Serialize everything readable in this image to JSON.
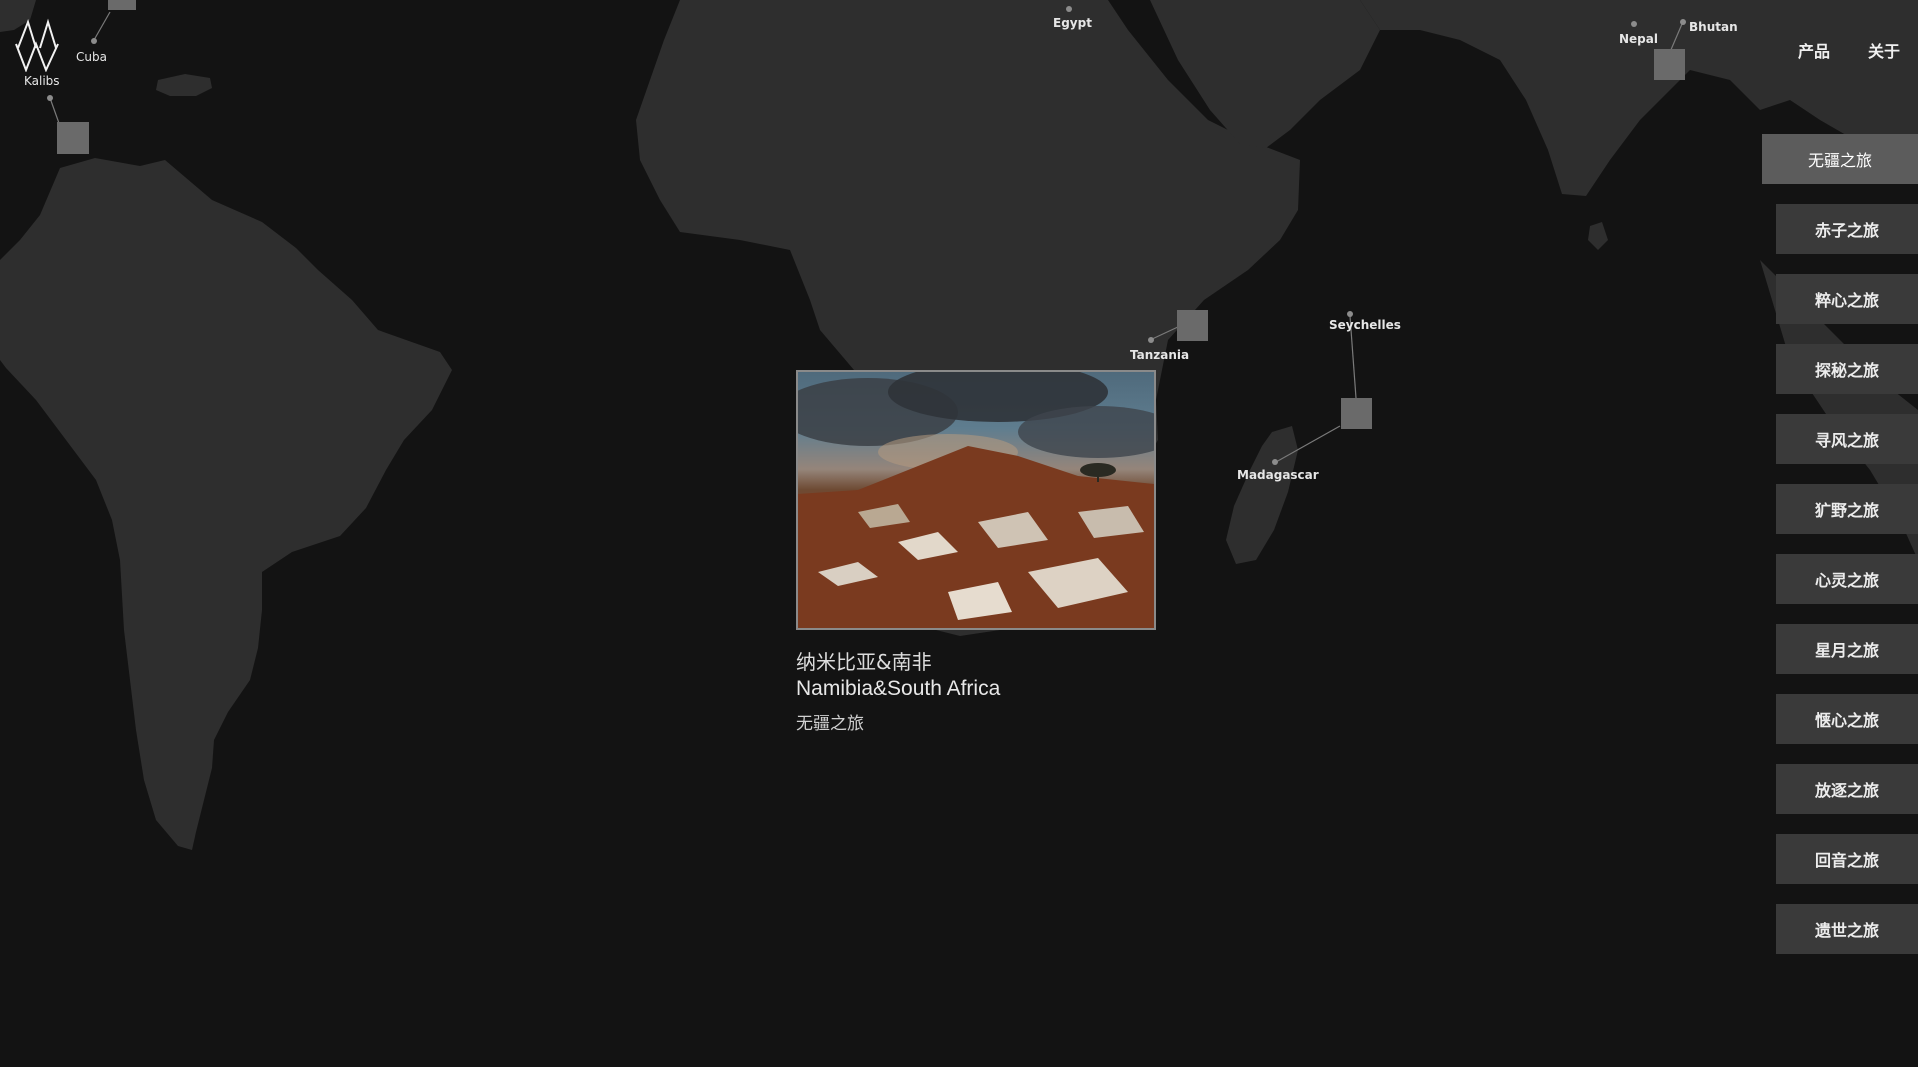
{
  "brand": {
    "name": "Kalibs"
  },
  "nav": {
    "items": [
      "产品",
      "关于"
    ]
  },
  "map": {
    "places": [
      "Cuba",
      "Kalibs",
      "Egypt",
      "Nepal",
      "Bhutan",
      "Tanzania",
      "Seychelles",
      "Madagascar"
    ]
  },
  "feature": {
    "title_cn": "纳米比亚&南非",
    "title_en": "Namibia&South Africa",
    "category": "无疆之旅"
  },
  "menu": {
    "items": [
      "无疆之旅",
      "赤子之旅",
      "粹心之旅",
      "探秘之旅",
      "寻风之旅",
      "犷野之旅",
      "心灵之旅",
      "星月之旅",
      "惬心之旅",
      "放逐之旅",
      "回音之旅",
      "遗世之旅"
    ],
    "active_index": 0
  },
  "colors": {
    "background": "#131313",
    "land": "#2e2e2e",
    "menu_item": "#3a3a3a",
    "menu_item_active": "#5c5c5c",
    "marker": "#6a6a6a"
  }
}
